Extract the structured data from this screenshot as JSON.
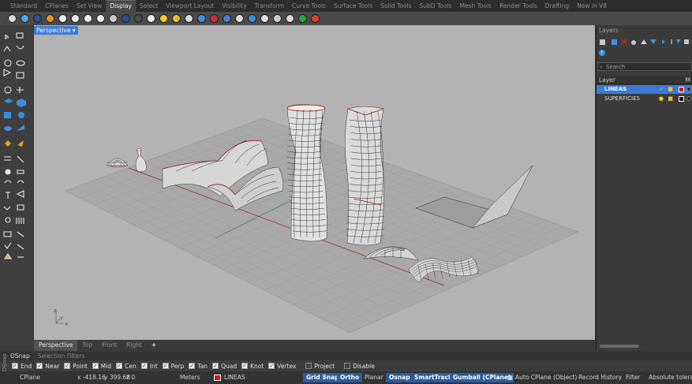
{
  "toolbar_tabs": [
    "Standard",
    "CPlanes",
    "Set View",
    "Display",
    "Select",
    "Viewport Layout",
    "Visibility",
    "Transform",
    "Curve Tools",
    "Surface Tools",
    "Solid Tools",
    "SubD Tools",
    "Mesh Tools",
    "Render Tools",
    "Drafting",
    "New in V8"
  ],
  "active_tab": "Display",
  "viewport": {
    "title": "Perspective",
    "tabs": [
      "Perspective",
      "Top",
      "Front",
      "Right"
    ],
    "add_tab": "+",
    "axis_x": "x",
    "axis_y": "y",
    "axis_z": "z"
  },
  "layers": {
    "title": "Layers",
    "search_placeholder": "Search",
    "column_layer": "Layer",
    "column_m": "M",
    "rows": [
      {
        "name": "LINEAS",
        "selected": true,
        "color": "#e01010"
      },
      {
        "name": "SUPERFICIES",
        "selected": false,
        "color": "#111111"
      }
    ]
  },
  "osnap": {
    "tabs": [
      "OSnap",
      "Selection Filters"
    ],
    "items": [
      {
        "label": "End",
        "checked": true
      },
      {
        "label": "Near",
        "checked": true
      },
      {
        "label": "Point",
        "checked": true
      },
      {
        "label": "Mid",
        "checked": true
      },
      {
        "label": "Cen",
        "checked": true
      },
      {
        "label": "Int",
        "checked": true
      },
      {
        "label": "Perp",
        "checked": true
      },
      {
        "label": "Tan",
        "checked": true
      },
      {
        "label": "Quad",
        "checked": true
      },
      {
        "label": "Knot",
        "checked": true
      },
      {
        "label": "Vertex",
        "checked": true
      },
      {
        "label": "Project",
        "checked": false
      },
      {
        "label": "Disable",
        "checked": false
      }
    ]
  },
  "status": {
    "cplane": "CPlane",
    "x": "x -418.16",
    "y": "y 399.68",
    "z": "z 0",
    "units": "Meters",
    "layer": "LINEAS",
    "layer_color": "#e01010",
    "grid_snap": "Grid Snap",
    "ortho": "Ortho",
    "planar": "Planar",
    "osnap": "Osnap",
    "smarttrack": "SmartTrack",
    "gumball": "Gumball (CPlane)",
    "auto_cplane": "Auto CPlane (Object)",
    "record_history": "Record History",
    "filter": "Filter",
    "tolerance": "Absolute toleranc"
  },
  "side_label": "OSnap",
  "colors": {
    "accent": "#3d7bd4",
    "viewport_bg": "#b3b3b3",
    "pill": "#2e5c9a"
  }
}
